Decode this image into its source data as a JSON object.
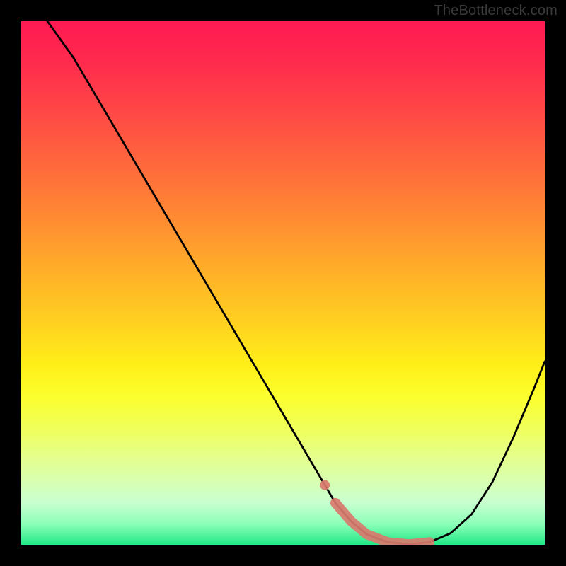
{
  "watermark": "TheBottleneck.com",
  "chart_data": {
    "type": "line",
    "title": "",
    "xlabel": "",
    "ylabel": "",
    "xlim": [
      0,
      100
    ],
    "ylim": [
      0,
      100
    ],
    "series": [
      {
        "name": "bottleneck-curve",
        "x": [
          5,
          10,
          15,
          20,
          25,
          30,
          35,
          40,
          45,
          50,
          55,
          58,
          60,
          63,
          66,
          70,
          74,
          78,
          82,
          86,
          90,
          94,
          98,
          100
        ],
        "y": [
          100,
          93,
          84.5,
          76,
          67.5,
          59,
          50.5,
          42,
          33.5,
          25,
          16.5,
          11.4,
          8,
          4.5,
          2,
          0.5,
          0.1,
          0.5,
          2.2,
          5.8,
          12,
          20.5,
          30,
          35
        ]
      },
      {
        "name": "optimal-marker",
        "x": [
          58,
          60,
          63,
          66,
          70,
          74,
          78
        ],
        "y": [
          11.4,
          8,
          4.5,
          2,
          0.5,
          0.1,
          0.5
        ]
      }
    ],
    "gradient_stops": [
      {
        "pos": 0,
        "color": "#ff1a52"
      },
      {
        "pos": 18,
        "color": "#ff4a45"
      },
      {
        "pos": 38,
        "color": "#ff8c32"
      },
      {
        "pos": 58,
        "color": "#ffd21f"
      },
      {
        "pos": 72,
        "color": "#fbff2f"
      },
      {
        "pos": 88,
        "color": "#d8ffb2"
      },
      {
        "pos": 100,
        "color": "#20e887"
      }
    ]
  }
}
